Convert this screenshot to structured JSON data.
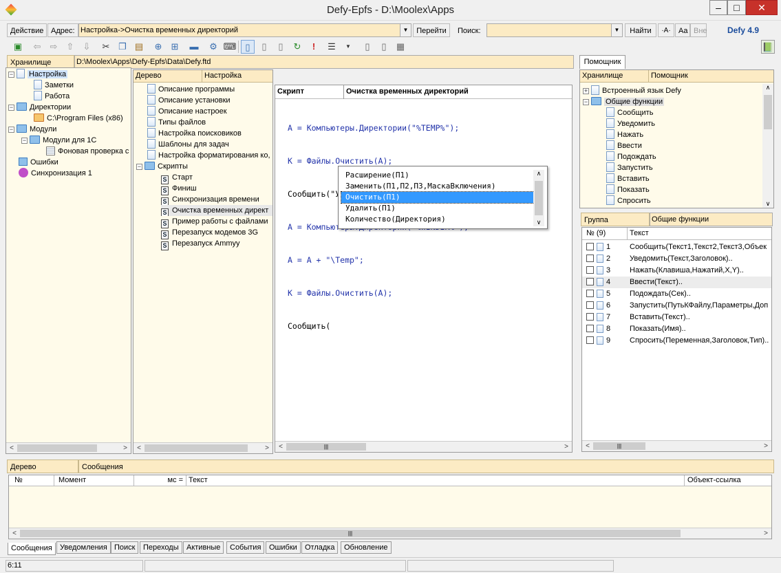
{
  "window": {
    "title": "Defy-Epfs - D:\\Moolex\\Apps",
    "min": "–",
    "max": "□",
    "close": "✕"
  },
  "addressbar": {
    "action_label": "Действие",
    "address_label": "Адрес:",
    "address_value": "Настройка->Очистка временных директорий",
    "go_label": "Перейти",
    "search_label": "Поиск:",
    "search_value": "",
    "find_label": "Найти",
    "case_a": "·A·",
    "case_aa": "Aa",
    "case_all": "Вне",
    "version": "Defy 4.9"
  },
  "storage": {
    "label": "Хранилище",
    "path": "D:\\Moolex\\Apps\\Defy-Epfs\\Data\\Defy.ftd"
  },
  "left_tree": [
    {
      "label": "Настройка",
      "selected": true
    },
    {
      "label": "Заметки"
    },
    {
      "label": "Работа"
    },
    {
      "label": "Директории"
    },
    {
      "label": "C:\\Program Files (x86)"
    },
    {
      "label": "Модули"
    },
    {
      "label": "Модули для 1С"
    },
    {
      "label": "Фоновая проверка с"
    },
    {
      "label": "Ошибки"
    },
    {
      "label": "Синхронизация 1"
    }
  ],
  "middle": {
    "col1": "Дерево",
    "col2": "Настройка",
    "items": [
      "Описание программы",
      "Описание установки",
      "Описание настроек",
      "Типы файлов",
      "Настройка поисковиков",
      "Шаблоны для задач",
      "Настройка форматирования ко,",
      "Скрипты"
    ],
    "scripts": [
      "Старт",
      "Финиш",
      "Синхронизация времени",
      "Очистка временных директ",
      "Пример работы с файлами",
      "Перезапуск модемов 3G",
      "Перезапуск Ammyy"
    ]
  },
  "editor": {
    "col1": "Скрипт",
    "col2": "Очистка временных директорий",
    "lines": [
      "А = Компьютеры.Директории(\"%TEMP%\");",
      "К = Файлы.Очистить(А);",
      "Сообщить(\"Удалено файлов и папок из \"+А, К);",
      "А = Компьютеры.Директории(\"%WINDIR%\");",
      "А = А + \"\\Temp\";",
      "К = Файлы.Очистить(А);",
      "Сообщить("
    ],
    "autocomplete": [
      "Расширение(П1)",
      "Заменить(П1,П2,П3,МаскаВключения)",
      "Очистить(П1)",
      "Удалить(П1)",
      "Количество(Директория)"
    ],
    "autocomplete_selected": 2
  },
  "helper": {
    "tab": "Помощник",
    "col1": "Хранилище",
    "col2": "Помощник",
    "tree": [
      {
        "label": "Встроенный язык Defy"
      },
      {
        "label": "Общие функции"
      }
    ],
    "functions": [
      "Сообщить",
      "Уведомить",
      "Нажать",
      "Ввести",
      "Подождать",
      "Запустить",
      "Вставить",
      "Показать",
      "Спросить"
    ],
    "group_label": "Группа",
    "group_value": "Общие функции",
    "table_headers": [
      "№ (9)",
      "Текст"
    ],
    "rows": [
      {
        "n": "1",
        "text": "Сообщить(Текст1,Текст2,Текст3,Объек"
      },
      {
        "n": "2",
        "text": "Уведомить(Текст,Заголовок).."
      },
      {
        "n": "3",
        "text": "Нажать(Клавиша,Нажатий,X,Y).."
      },
      {
        "n": "4",
        "text": "Ввести(Текст).."
      },
      {
        "n": "5",
        "text": "Подождать(Сек).."
      },
      {
        "n": "6",
        "text": "Запустить(ПутьКФайлу,Параметры,Доп"
      },
      {
        "n": "7",
        "text": "Вставить(Текст).."
      },
      {
        "n": "8",
        "text": "Показать(Имя).."
      },
      {
        "n": "9",
        "text": "Спросить(Переменная,Заголовок,Тип).."
      }
    ]
  },
  "messages": {
    "col1": "Дерево",
    "col2": "Сообщения",
    "headers": [
      "№",
      "Момент",
      "мс =",
      "Текст",
      "Объект-ссылка"
    ]
  },
  "tabs": [
    "Сообщения",
    "Уведомления",
    "Поиск",
    "Переходы",
    "Активные",
    "События",
    "Ошибки",
    "Отладка",
    "Обновление"
  ],
  "status": {
    "time": "6:11"
  }
}
